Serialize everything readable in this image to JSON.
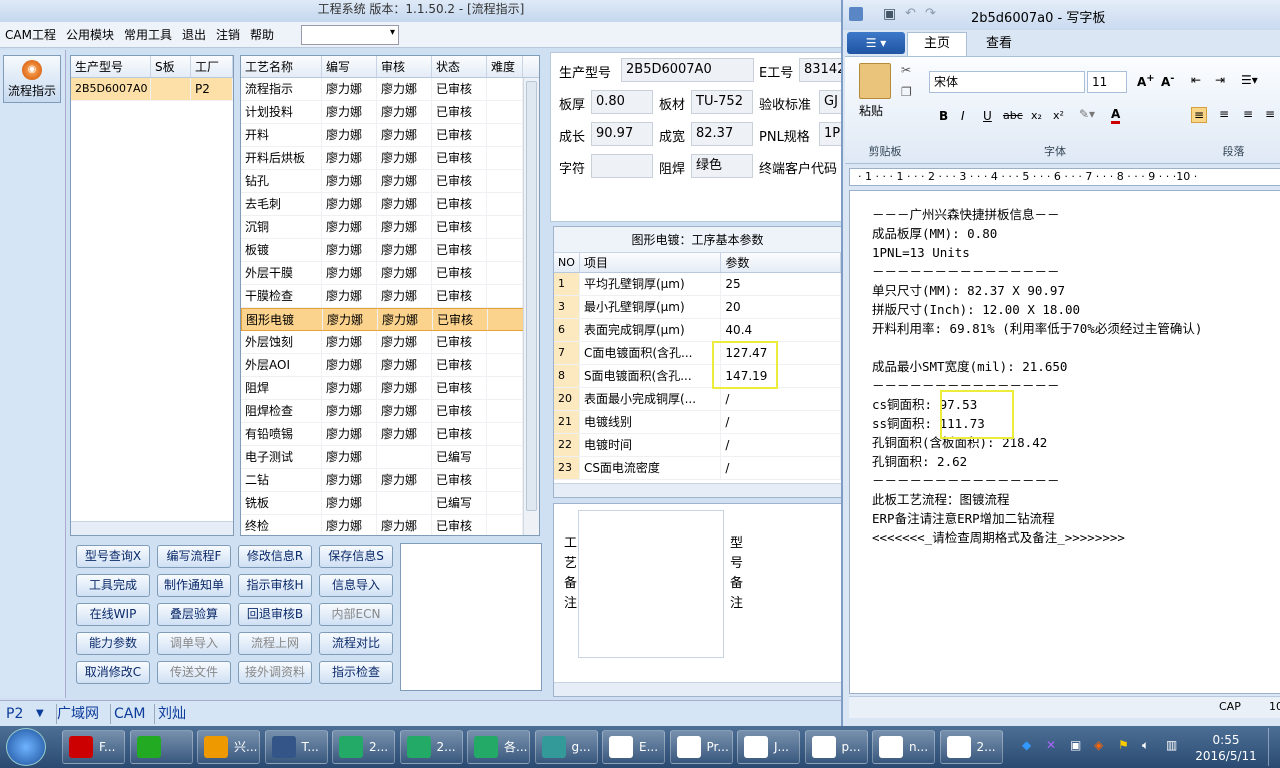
{
  "window": {
    "title": "工程系统 版本：1.1.50.2 - [流程指示]"
  },
  "menu": [
    "CAM工程",
    "公用模块",
    "常用工具",
    "退出",
    "注销",
    "帮助"
  ],
  "left": {
    "flow_button": "流程指示"
  },
  "model_grid": {
    "headers": [
      "生产型号",
      "S板",
      "工厂"
    ],
    "rows": [
      [
        "2B5D6007A0",
        "",
        "P2"
      ]
    ]
  },
  "process_grid": {
    "headers": [
      "工艺名称",
      "编写",
      "审核",
      "状态",
      "难度"
    ],
    "rows": [
      [
        "流程指示",
        "廖力娜",
        "廖力娜",
        "已审核",
        ""
      ],
      [
        "计划投料",
        "廖力娜",
        "廖力娜",
        "已审核",
        ""
      ],
      [
        "开料",
        "廖力娜",
        "廖力娜",
        "已审核",
        ""
      ],
      [
        "开料后烘板",
        "廖力娜",
        "廖力娜",
        "已审核",
        ""
      ],
      [
        "钻孔",
        "廖力娜",
        "廖力娜",
        "已审核",
        ""
      ],
      [
        "去毛刺",
        "廖力娜",
        "廖力娜",
        "已审核",
        ""
      ],
      [
        "沉铜",
        "廖力娜",
        "廖力娜",
        "已审核",
        ""
      ],
      [
        "板镀",
        "廖力娜",
        "廖力娜",
        "已审核",
        ""
      ],
      [
        "外层干膜",
        "廖力娜",
        "廖力娜",
        "已审核",
        ""
      ],
      [
        "干膜检查",
        "廖力娜",
        "廖力娜",
        "已审核",
        ""
      ],
      [
        "图形电镀",
        "廖力娜",
        "廖力娜",
        "已审核",
        ""
      ],
      [
        "外层蚀刻",
        "廖力娜",
        "廖力娜",
        "已审核",
        ""
      ],
      [
        "外层AOI",
        "廖力娜",
        "廖力娜",
        "已审核",
        ""
      ],
      [
        "阻焊",
        "廖力娜",
        "廖力娜",
        "已审核",
        ""
      ],
      [
        "阻焊检查",
        "廖力娜",
        "廖力娜",
        "已审核",
        ""
      ],
      [
        "有铅喷锡",
        "廖力娜",
        "廖力娜",
        "已审核",
        ""
      ],
      [
        "电子测试",
        "廖力娜",
        "",
        "已编写",
        ""
      ],
      [
        "二钻",
        "廖力娜",
        "廖力娜",
        "已审核",
        ""
      ],
      [
        "铣板",
        "廖力娜",
        "",
        "已编写",
        ""
      ],
      [
        "终检",
        "廖力娜",
        "廖力娜",
        "已审核",
        ""
      ]
    ],
    "selected": 10
  },
  "buttons": [
    [
      "型号查询X",
      "编写流程F",
      "修改信息R",
      "保存信息S"
    ],
    [
      "工具完成",
      "制作通知单",
      "指示审核H",
      "信息导入"
    ],
    [
      "在线WIP",
      "叠层验算",
      "回退审核B",
      "内部ECN"
    ],
    [
      "能力参数",
      "调单导入",
      "流程上网",
      "流程对比"
    ],
    [
      "取消修改C",
      "传送文件",
      "接外调资料",
      "指示检查"
    ]
  ],
  "info": {
    "model_label": "生产型号",
    "model": "2B5D6007A0",
    "eng_label": "E工号",
    "eng": "83142",
    "thick_label": "板厚",
    "thick": "0.80",
    "material_label": "板材",
    "material": "TU-752",
    "std_label": "验收标准",
    "std": "GJ",
    "len_label": "成长",
    "len": "90.97",
    "wid_label": "成宽",
    "wid": "82.37",
    "pnl_label": "PNL规格",
    "pnl": "1P",
    "char_label": "字符",
    "char": "",
    "mask_label": "阻焊",
    "mask": "绿色",
    "cust_label": "终端客户代码"
  },
  "param": {
    "title": "图形电镀：工序基本参数",
    "headers": [
      "NO",
      "项目",
      "参数"
    ],
    "rows": [
      [
        "1",
        "平均孔壁铜厚(μm)",
        "25"
      ],
      [
        "3",
        "最小孔壁铜厚(μm)",
        "20"
      ],
      [
        "6",
        "表面完成铜厚(μm)",
        "40.4"
      ],
      [
        "7",
        "C面电镀面积(含孔...",
        "127.47"
      ],
      [
        "8",
        "S面电镀面积(含孔...",
        "147.19"
      ],
      [
        "20",
        "表面最小完成铜厚(...",
        "/"
      ],
      [
        "21",
        "电镀线别",
        "/"
      ],
      [
        "22",
        "电镀时间",
        "/"
      ],
      [
        "23",
        "CS面电流密度",
        "/"
      ]
    ]
  },
  "remarks": {
    "proc": "工艺备注",
    "model": "型号备注"
  },
  "status": {
    "plant": "P2",
    "lan": "广域网",
    "cam": "CAM",
    "user": "刘灿"
  },
  "taskbar": {
    "items": [
      "F...",
      "",
      "兴...",
      "T...",
      "2...",
      "2...",
      "各...",
      "g...",
      "E...",
      "Pr...",
      "J...",
      "p...",
      "n...",
      "2..."
    ],
    "time": "0:55",
    "date": "2016/5/11"
  },
  "wordpad": {
    "title": "2b5d6007a0 - 写字板",
    "tabs": [
      "主页",
      "查看"
    ],
    "font": "宋体",
    "size": "11",
    "groups": [
      "剪贴板",
      "字体",
      "段落"
    ],
    "paste": "粘贴",
    "ruler": "· 1 · · · 1 · · · 2 · · · 3 · · · 4 · · · 5 · · · 6 · · · 7 · · · 8 · · · 9 · · ·10 ·",
    "lines": [
      "－－－广州兴森快捷拼板信息－－",
      "成品板厚(MM): 0.80",
      "1PNL=13 Units",
      "－－－－－－－－－－－－－－－",
      "单只尺寸(MM): 82.37 X 90.97",
      "拼版尺寸(Inch): 12.00 X 18.00",
      "开料利用率: 69.81% (利用率低于70%必须经过主管确认)",
      "",
      "成品最小SMT宽度(mil): 21.650",
      "－－－－－－－－－－－－－－－",
      "cs铜面积: 97.53",
      "ss铜面积: 111.73",
      "孔铜面积(含板面积): 218.42",
      "孔铜面积: 2.62",
      "－－－－－－－－－－－－－－－",
      "此板工艺流程：图镀流程",
      "ERP备注请注意ERP增加二钻流程",
      "<<<<<<<_请检查周期格式及备注_>>>>>>>>"
    ],
    "caps": "CAP",
    "num": "10"
  }
}
